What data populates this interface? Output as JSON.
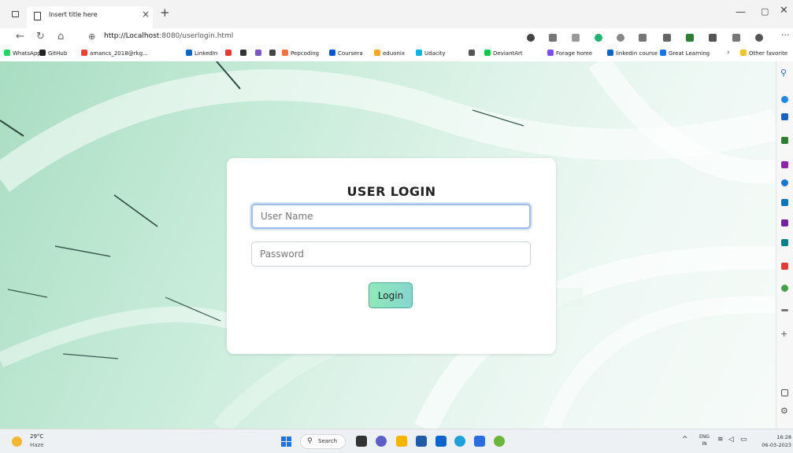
{
  "browser": {
    "tab_title": "Insert title here",
    "tab_close": "×",
    "new_tab": "+",
    "url_host": "http://Localhost",
    "url_path": ":8080/userlogin.html",
    "more": "···",
    "win_min": "—",
    "win_max": "▢",
    "win_close": "✕"
  },
  "bookmarks": [
    {
      "label": "WhatsApp",
      "color": "#25d366"
    },
    {
      "label": "GitHub",
      "color": "#222222"
    },
    {
      "label": "amancs_2018@rkg...",
      "color": "#ea4335"
    },
    {
      "label": "LinkedIn",
      "color": "#0a66c2"
    },
    {
      "label": "",
      "color": "#e53935"
    },
    {
      "label": "",
      "color": "#333333"
    },
    {
      "label": "",
      "color": "#7e57c2"
    },
    {
      "label": "",
      "color": "#444444"
    },
    {
      "label": "Pepcoding",
      "color": "#ff7043"
    },
    {
      "label": "Coursera",
      "color": "#0056d2"
    },
    {
      "label": "eduonix",
      "color": "#f9a825"
    },
    {
      "label": "Udacity",
      "color": "#02b3e4"
    },
    {
      "label": "",
      "color": "#555555"
    },
    {
      "label": "DeviantArt",
      "color": "#05cc47"
    },
    {
      "label": "Forage home",
      "color": "#7c4dff"
    },
    {
      "label": "linkedin course",
      "color": "#0a66c2"
    },
    {
      "label": "Great Learning",
      "color": "#1a73e8"
    }
  ],
  "bookmarks_more": "›",
  "other_favorites": "Other favorite",
  "login": {
    "title": "USER LOGIN",
    "username_placeholder": "User Name",
    "password_placeholder": "Password",
    "button_label": "Login"
  },
  "sidebar": {
    "add": "+"
  },
  "taskbar": {
    "temperature": "29°C",
    "condition": "Haze",
    "search_label": "Search",
    "lang_1": "ENG",
    "lang_2": "IN",
    "time": "16:28",
    "date": "06-03-2023"
  }
}
